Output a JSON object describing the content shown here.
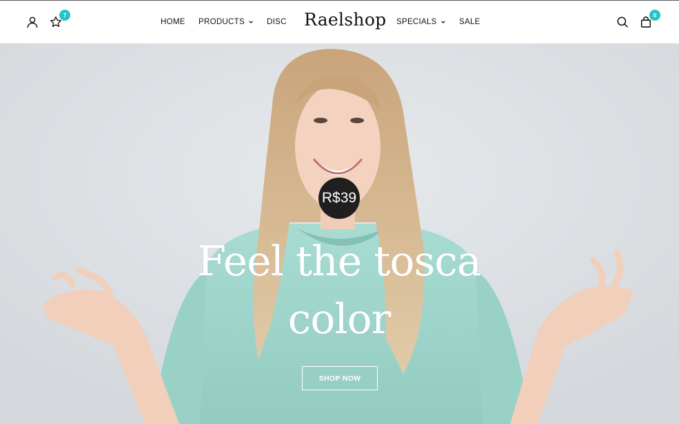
{
  "header": {
    "logo": "Raelshop",
    "wishlist_count": "7",
    "cart_count": "0",
    "nav": [
      {
        "label": "HOME",
        "has_dropdown": false
      },
      {
        "label": "PRODUCTS",
        "has_dropdown": true
      },
      {
        "label": "DISC",
        "has_dropdown": false
      },
      {
        "label": "SPECIALS",
        "has_dropdown": true
      },
      {
        "label": "SALE",
        "has_dropdown": false
      }
    ],
    "icons": [
      "user-icon",
      "star-icon",
      "search-icon",
      "shopping-bag-icon"
    ]
  },
  "hero": {
    "price": "R$39",
    "headline": "Feel the tosca color",
    "cta_label": "SHOP NOW"
  },
  "colors": {
    "badge": "#27c2c2",
    "price_bg": "#1f1f1f",
    "hero_bg": "#dee2e6",
    "sweater": "#9fd6cc"
  }
}
